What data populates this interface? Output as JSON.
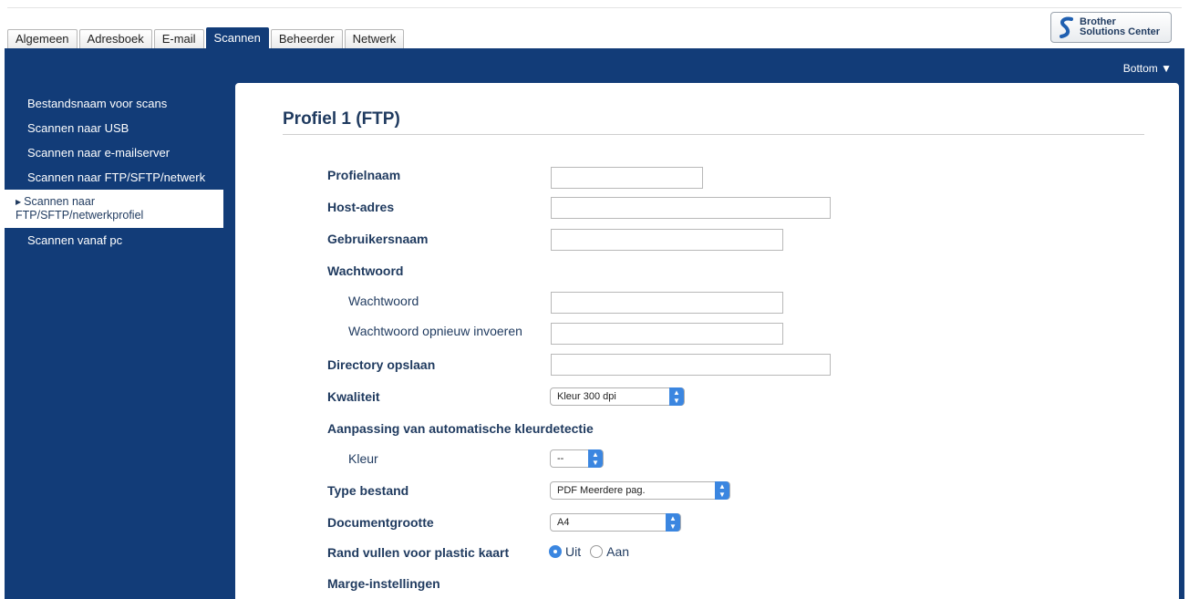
{
  "tabs": [
    {
      "label": "Algemeen",
      "active": false
    },
    {
      "label": "Adresboek",
      "active": false
    },
    {
      "label": "E-mail",
      "active": false
    },
    {
      "label": "Scannen",
      "active": true
    },
    {
      "label": "Beheerder",
      "active": false
    },
    {
      "label": "Netwerk",
      "active": false
    }
  ],
  "brother": {
    "line1": "Brother",
    "line2": "Solutions Center",
    "icon": "brother-logo-icon"
  },
  "bottom_link": "Bottom ▼",
  "sidebar": {
    "items": [
      {
        "label": "Bestandsnaam voor scans"
      },
      {
        "label": "Scannen naar USB"
      },
      {
        "label": "Scannen naar e-mailserver"
      },
      {
        "label": "Scannen naar FTP/SFTP/netwerk"
      },
      {
        "label": "Scannen naar FTP/SFTP/netwerkprofiel",
        "line1": "Scannen naar",
        "line2": "FTP/SFTP/netwerkprofiel",
        "active": true
      },
      {
        "label": "Scannen vanaf pc"
      }
    ]
  },
  "page": {
    "title": "Profiel 1 (FTP)"
  },
  "form": {
    "profilename": {
      "label": "Profielnaam",
      "value": ""
    },
    "host": {
      "label": "Host-adres",
      "value": ""
    },
    "username": {
      "label": "Gebruikersnaam",
      "value": ""
    },
    "password_section": {
      "label": "Wachtwoord"
    },
    "password": {
      "label": "Wachtwoord",
      "value": ""
    },
    "password_confirm": {
      "label": "Wachtwoord opnieuw invoeren",
      "value": ""
    },
    "directory": {
      "label": "Directory opslaan",
      "value": ""
    },
    "quality": {
      "label": "Kwaliteit",
      "selected": "Kleur 300 dpi"
    },
    "auto_color_section": {
      "label": "Aanpassing van automatische kleurdetectie"
    },
    "color": {
      "label": "Kleur",
      "selected": "--"
    },
    "file_type": {
      "label": "Type bestand",
      "selected": "PDF Meerdere pag."
    },
    "doc_size": {
      "label": "Documentgrootte",
      "selected": "A4"
    },
    "plastic_card": {
      "label": "Rand vullen voor plastic kaart",
      "options": [
        "Uit",
        "Aan"
      ],
      "selected": "Uit"
    },
    "margin_section": {
      "label": "Marge-instellingen"
    }
  },
  "colors": {
    "navy": "#123c78",
    "text": "#1f3a5f",
    "accent": "#3b86e0"
  }
}
